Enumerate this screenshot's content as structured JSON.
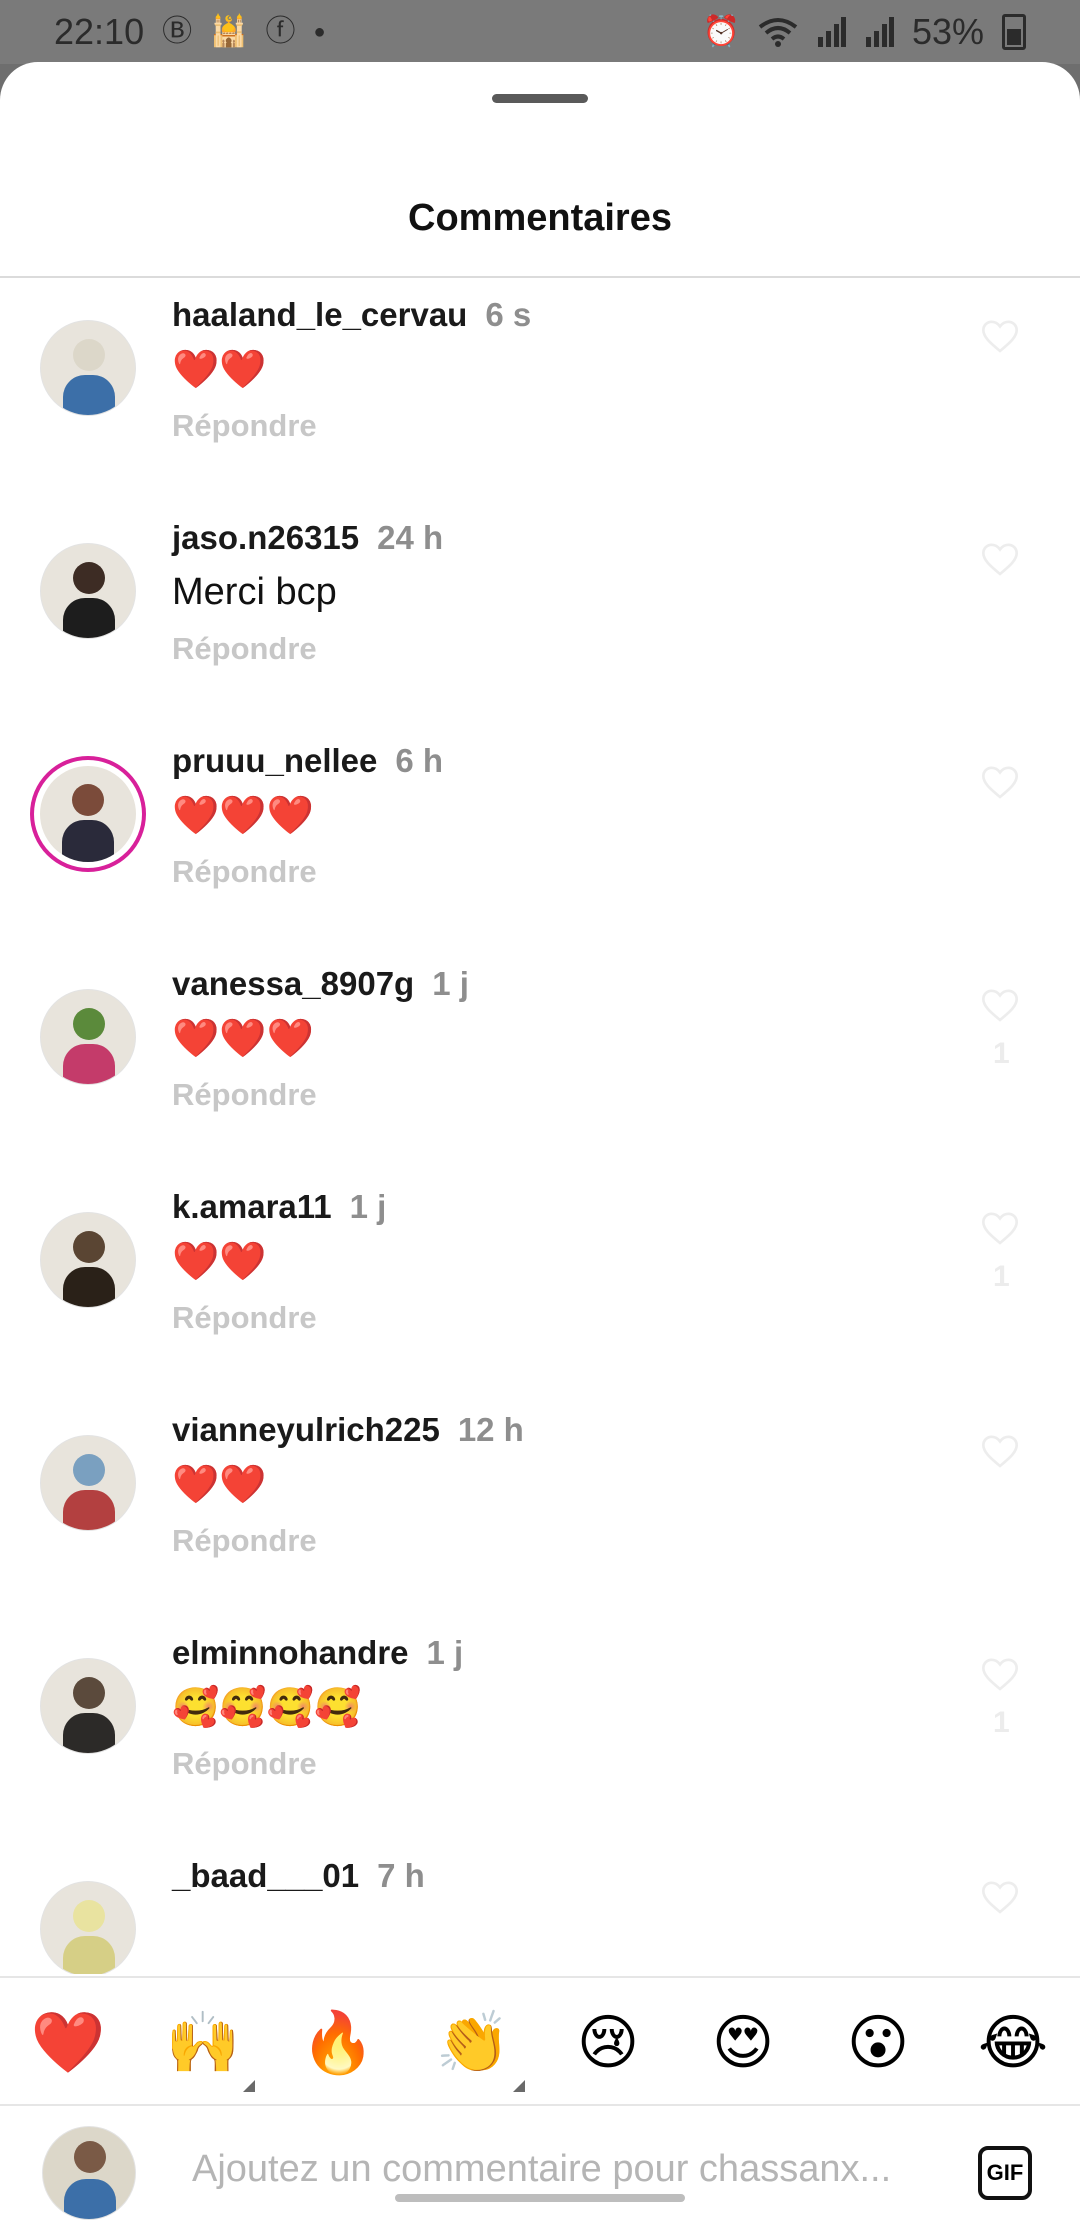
{
  "status_bar": {
    "time": "22:10",
    "battery_text": "53%",
    "left_icons": [
      "b-icon",
      "mosque-icon",
      "facebook-icon",
      "dot"
    ],
    "right_icons": [
      "alarm-icon",
      "wifi-icon",
      "signal-icon",
      "signal-icon"
    ]
  },
  "header": {
    "title": "Commentaires"
  },
  "comments": [
    {
      "username": "haaland_le_cervau",
      "time": "6 s",
      "text": "❤️❤️",
      "reply": "Répondre",
      "likes": "",
      "avatar_colors": [
        "#dcd7c9",
        "#3c6fa8"
      ]
    },
    {
      "username": "jaso.n26315",
      "time": "24 h",
      "text": "Merci bcp",
      "reply": "Répondre",
      "likes": "",
      "avatar_colors": [
        "#3d2c24",
        "#1d1d1d"
      ]
    },
    {
      "username": "pruuu_nellee",
      "time": "6 h",
      "text": "❤️❤️❤️",
      "reply": "Répondre",
      "likes": "",
      "story": true,
      "avatar_colors": [
        "#7b4b3a",
        "#2a2a3a"
      ]
    },
    {
      "username": "vanessa_8907g",
      "time": "1 j",
      "text": "❤️❤️❤️",
      "reply": "Répondre",
      "likes": "1",
      "avatar_colors": [
        "#5b8a3b",
        "#c43b6a"
      ]
    },
    {
      "username": "k.amara11",
      "time": "1 j",
      "text": "❤️❤️",
      "reply": "Répondre",
      "likes": "1",
      "avatar_colors": [
        "#5a4533",
        "#2a2118"
      ]
    },
    {
      "username": "vianneyulrich225",
      "time": "12 h",
      "text": "❤️❤️",
      "reply": "Répondre",
      "likes": "",
      "avatar_colors": [
        "#7aa0c0",
        "#b34040"
      ]
    },
    {
      "username": "elminnohandre",
      "time": "1 j",
      "text": "🥰🥰🥰🥰",
      "reply": "Répondre",
      "likes": "1",
      "avatar_colors": [
        "#5b4a3c",
        "#2c2a28"
      ]
    },
    {
      "username": "_baad___01",
      "time": "7 h",
      "text": "",
      "reply": "",
      "likes": "",
      "avatar_colors": [
        "#e9e3a0",
        "#d6cf86"
      ]
    }
  ],
  "emoji_bar": [
    {
      "emoji": "❤️",
      "name": "red-heart",
      "has_variants": false
    },
    {
      "emoji": "🙌",
      "name": "raising-hands",
      "has_variants": true
    },
    {
      "emoji": "🔥",
      "name": "fire",
      "has_variants": false
    },
    {
      "emoji": "👏",
      "name": "clapping-hands",
      "has_variants": true
    },
    {
      "emoji": "😢",
      "name": "crying-face",
      "has_variants": false
    },
    {
      "emoji": "😍",
      "name": "heart-eyes",
      "has_variants": false
    },
    {
      "emoji": "😮",
      "name": "open-mouth",
      "has_variants": false
    },
    {
      "emoji": "😂",
      "name": "tears-of-joy",
      "has_variants": false
    }
  ],
  "composer": {
    "placeholder": "Ajoutez un commentaire pour chassanx...",
    "gif_label": "GIF"
  }
}
